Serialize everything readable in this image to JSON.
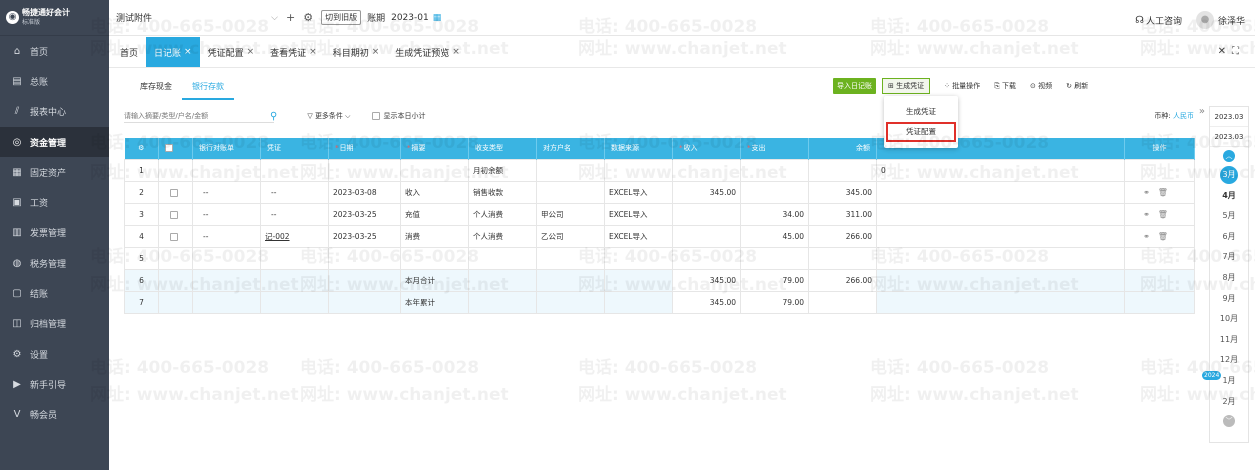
{
  "brand": {
    "name": "畅捷通好会计",
    "sub": "标准版"
  },
  "sidebar": {
    "items": [
      {
        "icon": "home-icon",
        "glyph": "⌂",
        "label": "首页"
      },
      {
        "icon": "ledger-icon",
        "glyph": "▤",
        "label": "总账"
      },
      {
        "icon": "chart-icon",
        "glyph": "⫽",
        "label": "报表中心"
      },
      {
        "icon": "money-icon",
        "glyph": "◎",
        "label": "资金管理",
        "active": true
      },
      {
        "icon": "asset-icon",
        "glyph": "▦",
        "label": "固定资产"
      },
      {
        "icon": "salary-icon",
        "glyph": "▣",
        "label": "工资"
      },
      {
        "icon": "invoice-icon",
        "glyph": "▥",
        "label": "发票管理"
      },
      {
        "icon": "tax-icon",
        "glyph": "◍",
        "label": "税务管理"
      },
      {
        "icon": "close-books-icon",
        "glyph": "▢",
        "label": "结账"
      },
      {
        "icon": "archive-icon",
        "glyph": "◫",
        "label": "归档管理"
      },
      {
        "icon": "settings-icon",
        "glyph": "⚙",
        "label": "设置"
      },
      {
        "icon": "guide-icon",
        "glyph": "▶",
        "label": "新手引导"
      },
      {
        "icon": "member-icon",
        "glyph": "V",
        "label": "畅会员"
      }
    ]
  },
  "topbar": {
    "company": "测试附件",
    "switch_label": "切到旧版",
    "period_label": "账期",
    "period_value": "2023-01",
    "support": "人工咨询",
    "user": "徐泽华"
  },
  "tabs": [
    {
      "label": "首页",
      "closable": false
    },
    {
      "label": "日记账",
      "closable": true,
      "active": true
    },
    {
      "label": "凭证配置",
      "closable": true
    },
    {
      "label": "查看凭证",
      "closable": true
    },
    {
      "label": "科目期初",
      "closable": true
    },
    {
      "label": "生成凭证预览",
      "closable": true
    }
  ],
  "subtabs": [
    {
      "label": "库存现金"
    },
    {
      "label": "银行存款",
      "active": true
    }
  ],
  "toolbar": {
    "import_label": "导入日记账",
    "generate_label": "生成凭证",
    "batch_label": "批量操作",
    "download_label": "下载",
    "video_label": "视频",
    "refresh_label": "刷新"
  },
  "dropdown": {
    "items": [
      {
        "label": "生成凭证"
      },
      {
        "label": "凭证配置",
        "highlight": true
      }
    ]
  },
  "search": {
    "placeholder": "请输入摘要/类型/户名/金额",
    "more_label": "更多条件",
    "show_subtotal": "显示本日小计",
    "currency_label": "币种:",
    "currency_value": "人民币"
  },
  "table": {
    "columns": [
      "⚙",
      "",
      "银行对账单",
      "凭证",
      "日期",
      "摘要",
      "收支类型",
      "对方户名",
      "数据来源",
      "收入",
      "支出",
      "余额",
      "",
      "操作"
    ],
    "rows": [
      {
        "no": "1",
        "cells": [
          "",
          "",
          "",
          "",
          "",
          "月初余额",
          "",
          "",
          "",
          "",
          "",
          "0",
          ""
        ],
        "type": "first"
      },
      {
        "no": "2",
        "cells": [
          "cb",
          "--",
          "--",
          "2023-03-08",
          "收入",
          "销售收款",
          "",
          "EXCEL导入",
          "345.00",
          "",
          "345.00",
          "",
          "ops"
        ]
      },
      {
        "no": "3",
        "cells": [
          "cb",
          "--",
          "--",
          "2023-03-25",
          "充值",
          "个人消费",
          "甲公司",
          "EXCEL导入",
          "",
          "34.00",
          "311.00",
          "",
          "ops"
        ]
      },
      {
        "no": "4",
        "cells": [
          "cb",
          "--",
          "记-002",
          "2023-03-25",
          "消费",
          "个人消费",
          "乙公司",
          "EXCEL导入",
          "",
          "45.00",
          "266.00",
          "",
          "ops"
        ]
      },
      {
        "no": "5",
        "cells": [
          "",
          "",
          "",
          "",
          "",
          "",
          "",
          "",
          "",
          "",
          "",
          "",
          ""
        ]
      },
      {
        "no": "6",
        "cells": [
          "",
          "",
          "",
          "",
          "本月合计",
          "",
          "",
          "",
          "345.00",
          "79.00",
          "266.00",
          "",
          ""
        ],
        "type": "sum"
      },
      {
        "no": "7",
        "cells": [
          "",
          "",
          "",
          "",
          "本年累计",
          "",
          "",
          "",
          "345.00",
          "79.00",
          "",
          "",
          ""
        ],
        "type": "sum"
      }
    ]
  },
  "months": {
    "years": [
      "2023.03",
      "2023.03"
    ],
    "current": "3月",
    "list": [
      "4月",
      "5月",
      "6月",
      "7月",
      "8月",
      "9月",
      "10月",
      "11月",
      "12月",
      "1月",
      "2月"
    ],
    "next_year_badge": "2024"
  },
  "watermark": {
    "phone": "电话: 400-665-0028",
    "site": "网址: www.chanjet.net"
  }
}
